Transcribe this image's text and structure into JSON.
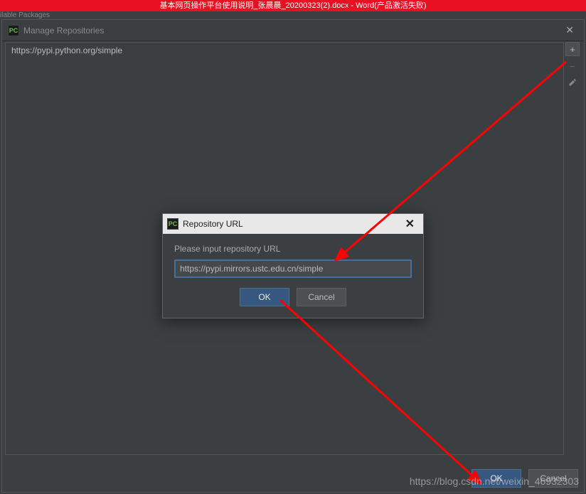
{
  "background": {
    "word_title": "基本网页操作平台使用说明_张晨晨_20200323(2).docx - Word(产品激活失败)",
    "truncated_label": "ilable Packages"
  },
  "main_window": {
    "icon_text": "PC",
    "title": "Manage Repositories",
    "repo_items": [
      "https://pypi.python.org/simple"
    ],
    "side_buttons": {
      "add": "+",
      "remove": "−",
      "edit": "edit"
    },
    "footer": {
      "ok": "OK",
      "cancel": "Cancel"
    }
  },
  "modal": {
    "icon_text": "PC",
    "title": "Repository URL",
    "label": "Please input repository URL",
    "input_value": "https://pypi.mirrors.ustc.edu.cn/simple",
    "ok": "OK",
    "cancel": "Cancel"
  },
  "watermark": "https://blog.csdn.net/weixin_46932303",
  "annotation": {
    "color": "#ff0000"
  }
}
